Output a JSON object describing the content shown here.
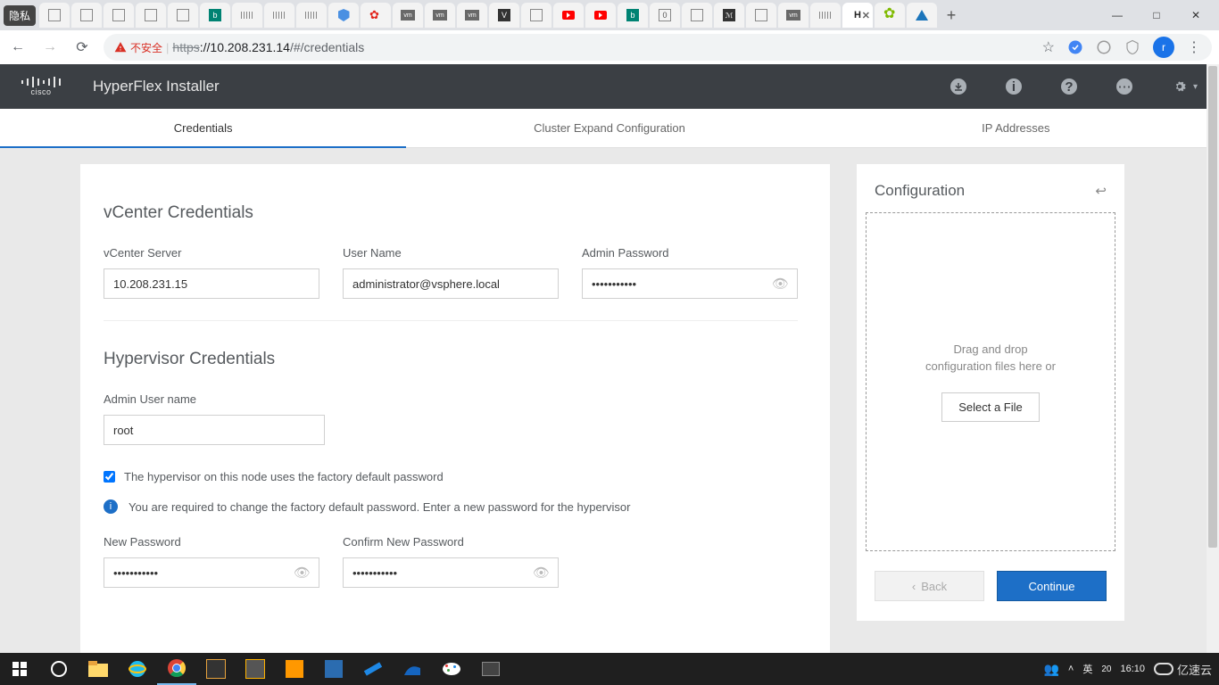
{
  "browser": {
    "incognito_label": "隐私",
    "active_tab_prefix": "H",
    "url_https": "https",
    "url_host": "://10.208.231.14",
    "url_path": "/#/credentials",
    "unsafe_label": "不安全",
    "profile_letter": "r"
  },
  "header": {
    "brand": "cisco",
    "title": "HyperFlex Installer"
  },
  "steps": {
    "credentials": "Credentials",
    "cluster": "Cluster Expand Configuration",
    "ip": "IP Addresses"
  },
  "vcenter": {
    "section_title": "vCenter Credentials",
    "server_label": "vCenter Server",
    "server_value": "10.208.231.15",
    "user_label": "User Name",
    "user_value": "administrator@vsphere.local",
    "pass_label": "Admin Password",
    "pass_value": "•••••••••••"
  },
  "hypervisor": {
    "section_title": "Hypervisor Credentials",
    "admin_user_label": "Admin User name",
    "admin_user_value": "root",
    "factory_default_label": "The hypervisor on this node uses the factory default password",
    "change_info": "You are required to change the factory default password. Enter a new password for the hypervisor",
    "new_pass_label": "New Password",
    "new_pass_value": "•••••••••••",
    "confirm_pass_label": "Confirm New Password",
    "confirm_pass_value": "•••••••••••"
  },
  "sidebar": {
    "title": "Configuration",
    "drop_line1": "Drag and drop",
    "drop_line2": "configuration files here or",
    "select_file": "Select a File",
    "back": "Back",
    "continue": "Continue"
  },
  "taskbar": {
    "ime": "英",
    "time": "16:10",
    "watermark": "亿速云"
  }
}
